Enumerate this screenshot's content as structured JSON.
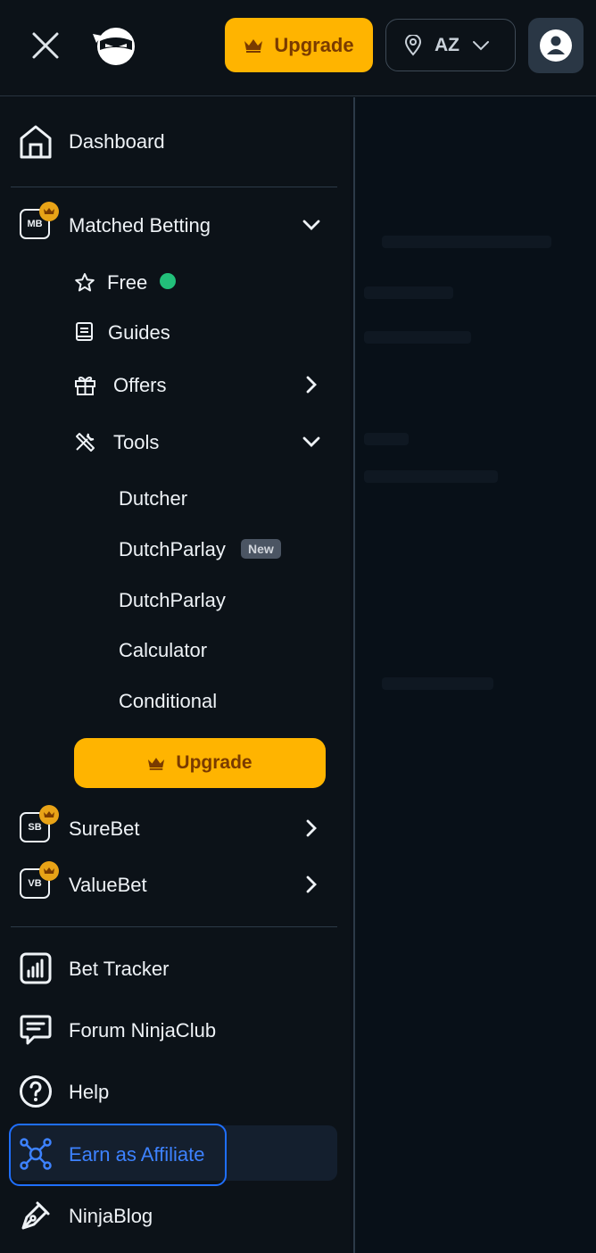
{
  "header": {
    "upgrade_label": "Upgrade",
    "region_code": "AZ",
    "icons": {
      "close": "close-icon",
      "logo": "ninja-logo-icon",
      "crown": "crown-icon",
      "location": "location-pin-icon",
      "chevron": "chevron-down-icon",
      "user": "user-icon"
    }
  },
  "menu": {
    "dashboard": "Dashboard",
    "matched_betting": {
      "label": "Matched Betting",
      "badge": "MB"
    },
    "free": "Free",
    "guides": "Guides",
    "offers": "Offers",
    "tools": "Tools",
    "tools_items": {
      "dutcher": "Dutcher",
      "dutchparlay_new": "DutchParlay",
      "new_tag": "New",
      "dutchparlay": "DutchParlay",
      "calculator": "Calculator",
      "conditional": "Conditional"
    },
    "upgrade_label": "Upgrade",
    "surebet": {
      "label": "SureBet",
      "badge": "SB"
    },
    "valuebet": {
      "label": "ValueBet",
      "badge": "VB"
    },
    "bet_tracker": "Bet Tracker",
    "forum": "Forum NinjaClub",
    "help": "Help",
    "affiliate": "Earn as Affiliate",
    "blog": "NinjaBlog"
  },
  "colors": {
    "accent": "#ffb400",
    "accent_text": "#7a3b00",
    "background": "#0c1218",
    "status_green": "#22c07a",
    "focus_blue": "#1f6fff",
    "crown_badge": "#e8a317"
  }
}
